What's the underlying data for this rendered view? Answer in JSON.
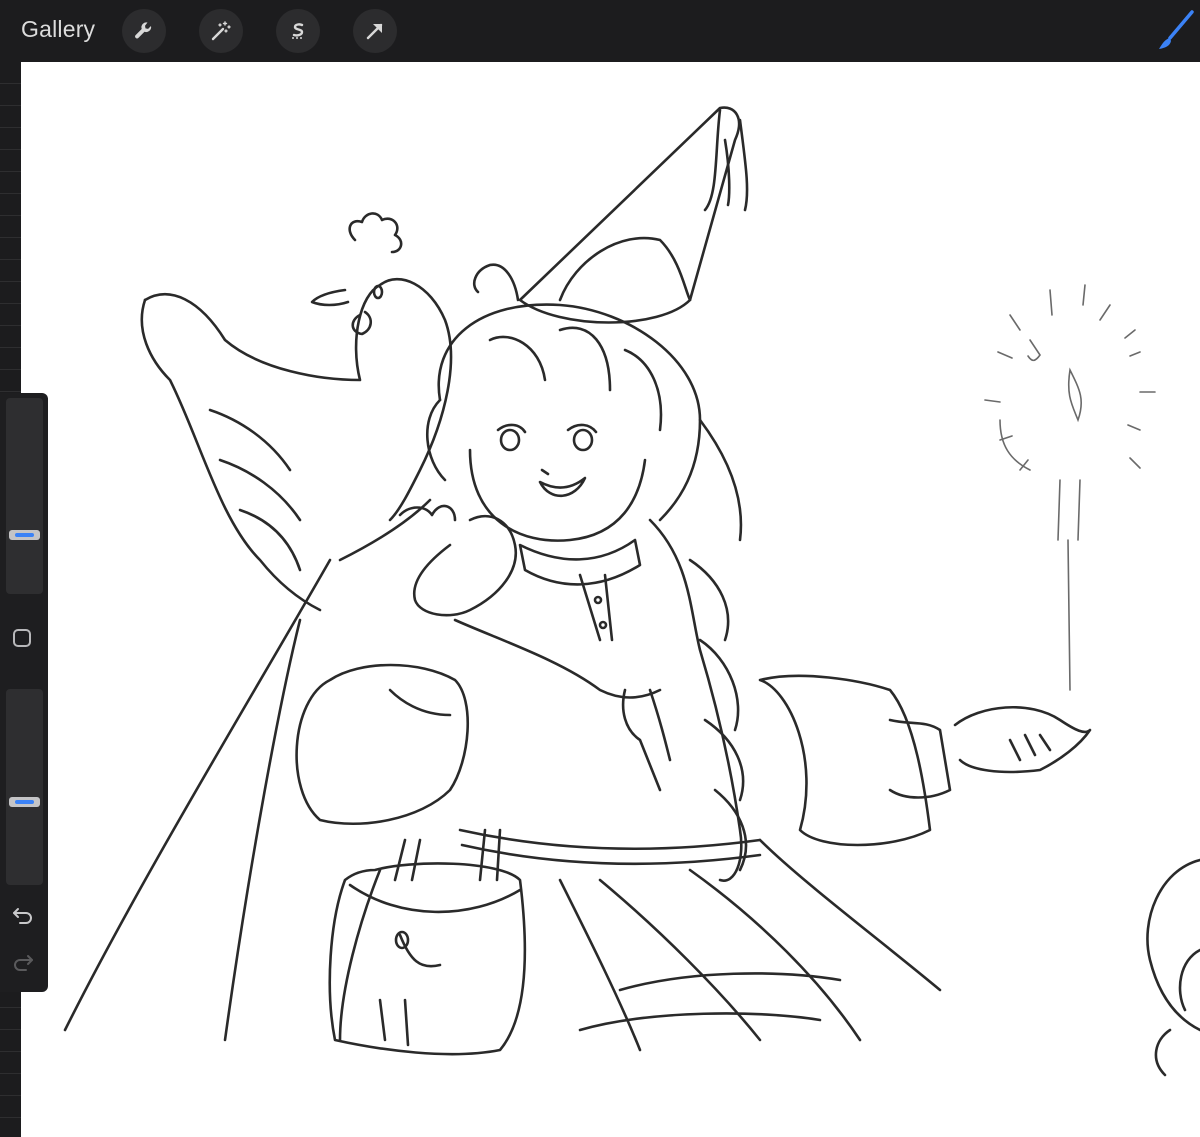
{
  "toolbar": {
    "gallery_label": "Gallery",
    "tools": [
      "wrench-icon",
      "magic-wand-icon",
      "selection-s-icon",
      "transform-arrow-icon"
    ],
    "brush_icon": "paintbrush-icon",
    "brush_color": "#3b82f6"
  },
  "sidebar": {
    "brush_size_level": 0.29,
    "opacity_level": 0.42,
    "accent_color": "#3b82f6",
    "icons": [
      "modify-square-icon",
      "undo-icon",
      "redo-icon"
    ]
  },
  "canvas": {
    "background": "#ffffff",
    "content": "line-art-sketch"
  }
}
